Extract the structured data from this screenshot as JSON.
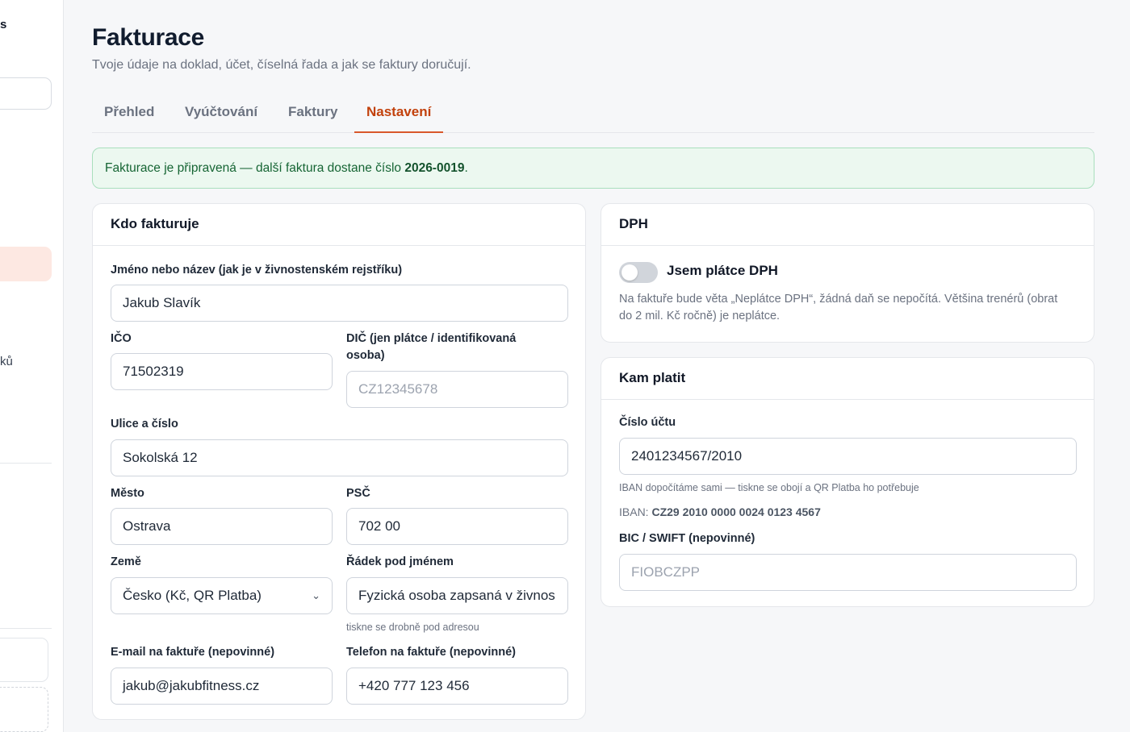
{
  "sidebar": {
    "brand_fragment": "s",
    "item_fragment": "ků"
  },
  "page": {
    "title": "Fakturace",
    "subtitle": "Tvoje údaje na doklad, účet, číselná řada a jak se faktury doručují."
  },
  "tabs": [
    {
      "label": "Přehled",
      "active": false
    },
    {
      "label": "Vyúčtování",
      "active": false
    },
    {
      "label": "Faktury",
      "active": false
    },
    {
      "label": "Nastavení",
      "active": true
    }
  ],
  "notice": {
    "text": "Fakturace je připravená — další faktura dostane číslo ",
    "number": "2026-0019",
    "suffix": "."
  },
  "issuer": {
    "heading": "Kdo fakturuje",
    "name_label": "Jméno nebo název (jak je v živnostenském rejstříku)",
    "name_value": "Jakub Slavík",
    "ico_label": "IČO",
    "ico_value": "71502319",
    "dic_label": "DIČ (jen plátce / identifikovaná osoba)",
    "dic_placeholder": "CZ12345678",
    "street_label": "Ulice a číslo",
    "street_value": "Sokolská 12",
    "city_label": "Město",
    "city_value": "Ostrava",
    "zip_label": "PSČ",
    "zip_value": "702 00",
    "country_label": "Země",
    "country_value": "Česko (Kč, QR Platba)",
    "subline_label": "Řádek pod jménem",
    "subline_value": "Fyzická osoba zapsaná v živnos",
    "subline_hint": "tiskne se drobně pod adresou",
    "email_label": "E-mail na faktuře (nepovinné)",
    "email_value": "jakub@jakubfitness.cz",
    "phone_label": "Telefon na faktuře (nepovinné)",
    "phone_value": "+420 777 123 456"
  },
  "vat": {
    "heading": "DPH",
    "toggle_label": "Jsem plátce DPH",
    "toggle_on": false,
    "description": "Na faktuře bude věta „Neplátce DPH“, žádná daň se nepočítá. Většina trenérů (obrat do 2 mil. Kč ročně) je neplátce."
  },
  "payment": {
    "heading": "Kam platit",
    "account_label": "Číslo účtu",
    "account_value": "2401234567/2010",
    "account_hint": "IBAN dopočítáme sami — tiskne se obojí a QR Platba ho potřebuje",
    "iban_prefix": "IBAN: ",
    "iban_value": "CZ29 2010 0000 0024 0123 4567",
    "bic_label": "BIC / SWIFT (nepovinné)",
    "bic_placeholder": "FIOBCZPP"
  },
  "colors": {
    "accent": "#d9582b",
    "success_bg": "#ecf8f0",
    "success_text": "#166534"
  }
}
